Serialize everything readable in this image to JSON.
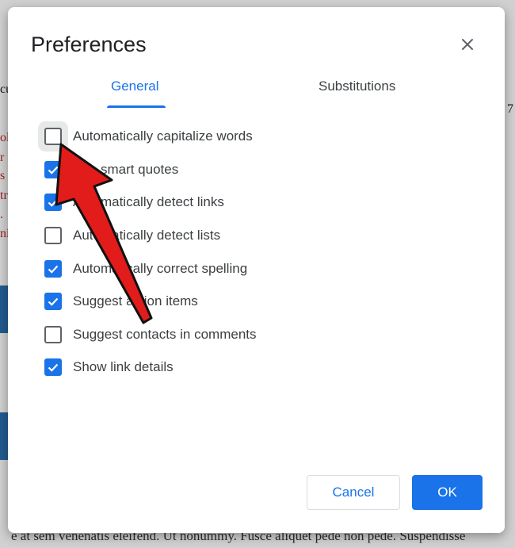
{
  "background": {
    "fragments": [
      "cu",
      "ol",
      "r",
      "s",
      "tr",
      ".",
      "ni",
      "7"
    ],
    "bottom_text": "e at sem venenatis eleifend. Ut nonummy. Fusce aliquet pede non pede. Suspendisse"
  },
  "dialog": {
    "title": "Preferences",
    "close_icon": "close-icon",
    "tabs": [
      {
        "label": "General",
        "active": true
      },
      {
        "label": "Substitutions",
        "active": false
      }
    ],
    "options": [
      {
        "label": "Automatically capitalize words",
        "checked": false
      },
      {
        "label": "Use smart quotes",
        "checked": true
      },
      {
        "label": "Automatically detect links",
        "checked": true
      },
      {
        "label": "Automatically detect lists",
        "checked": false
      },
      {
        "label": "Automatically correct spelling",
        "checked": true
      },
      {
        "label": "Suggest action items",
        "checked": true
      },
      {
        "label": "Suggest contacts in comments",
        "checked": false
      },
      {
        "label": "Show link details",
        "checked": true
      }
    ],
    "buttons": {
      "cancel": "Cancel",
      "ok": "OK"
    }
  },
  "colors": {
    "accent": "#1a73e8",
    "arrow": "#e21b1b"
  }
}
